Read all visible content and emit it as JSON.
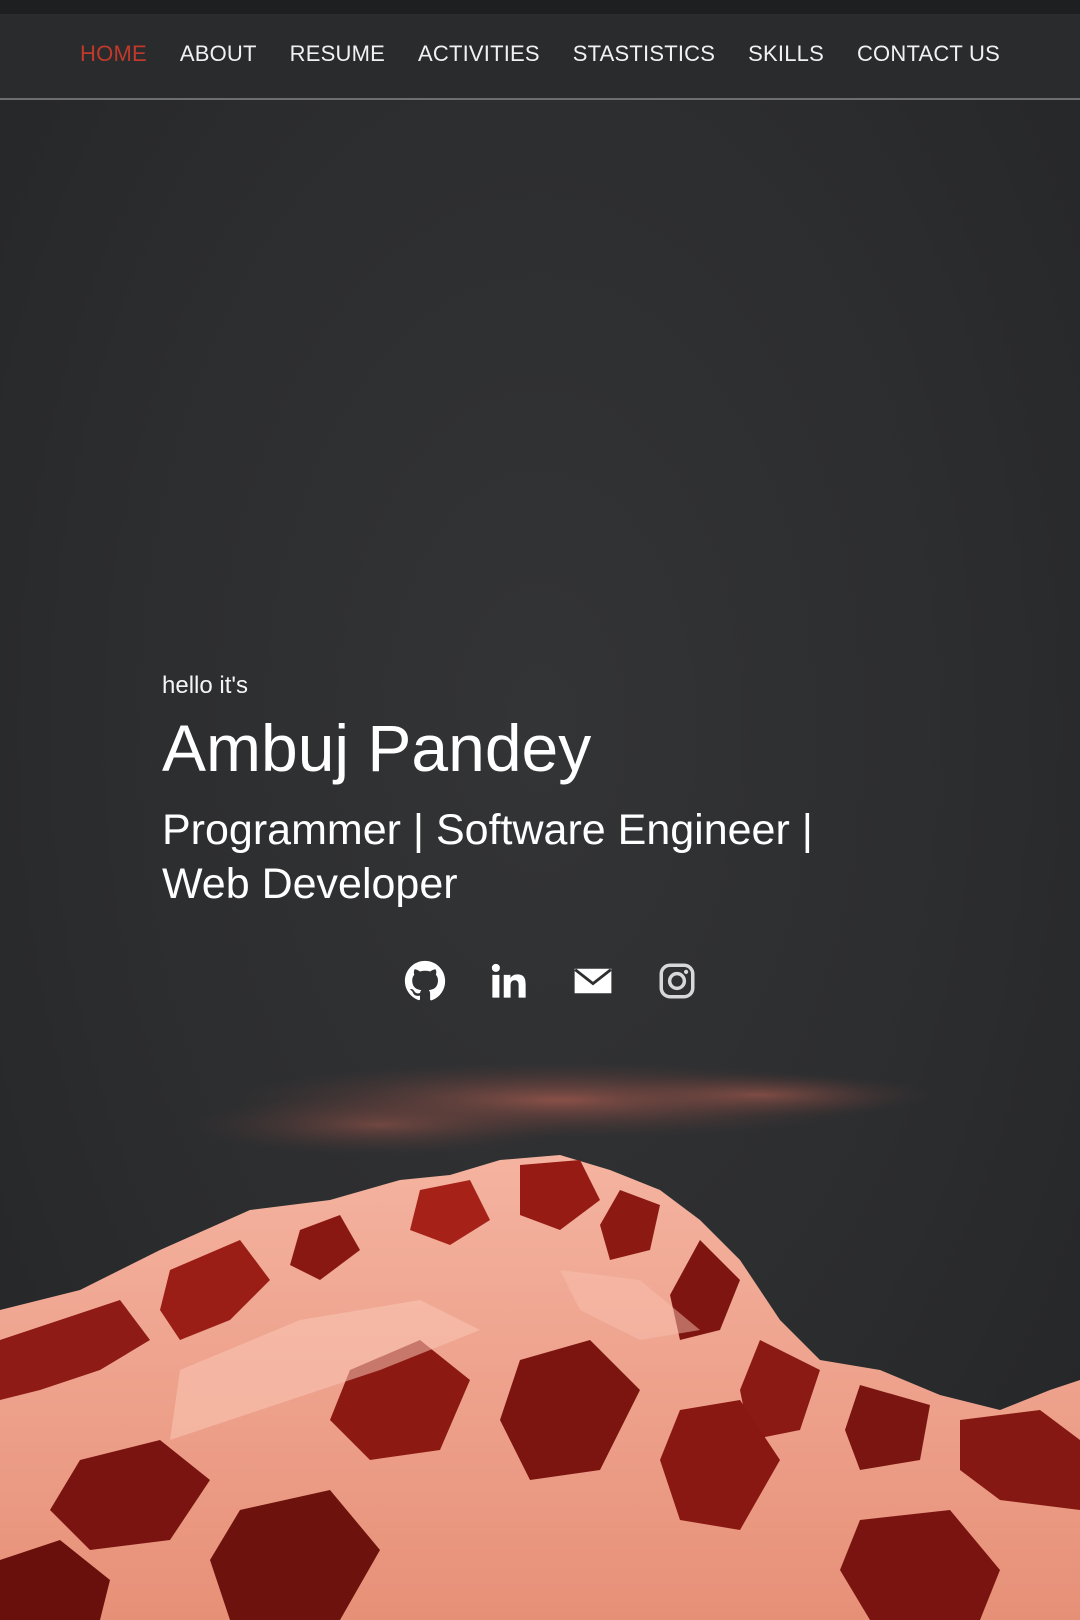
{
  "nav": {
    "items": [
      {
        "label": "HOME",
        "active": true
      },
      {
        "label": "ABOUT",
        "active": false
      },
      {
        "label": "RESUME",
        "active": false
      },
      {
        "label": "ACTIVITIES",
        "active": false
      },
      {
        "label": "STASTISTICS",
        "active": false
      },
      {
        "label": "SKILLS",
        "active": false
      },
      {
        "label": "CONTACT US",
        "active": false
      }
    ]
  },
  "hero": {
    "greeting": "hello it's",
    "name": "Ambuj Pandey",
    "roles": "Programmer | Software Engineer | Web Developer"
  },
  "socials": [
    {
      "icon": "github-icon"
    },
    {
      "icon": "linkedin-icon"
    },
    {
      "icon": "email-icon"
    },
    {
      "icon": "instagram-icon"
    }
  ],
  "colors": {
    "accent": "#c0392b",
    "background": "#2b2c2e",
    "text": "#ffffff"
  }
}
